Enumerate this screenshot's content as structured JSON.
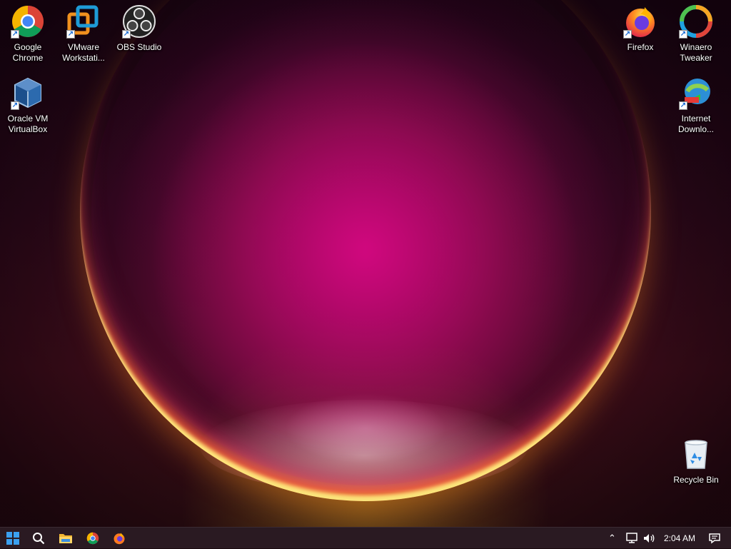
{
  "desktop": {
    "icons_left": [
      {
        "name": "google-chrome",
        "label": "Google\nChrome"
      },
      {
        "name": "vmware-workstation",
        "label": "VMware\nWorkstati..."
      },
      {
        "name": "obs-studio",
        "label": "OBS Studio"
      },
      {
        "name": "oracle-vm-virtualbox",
        "label": "Oracle VM\nVirtualBox"
      }
    ],
    "icons_right": [
      {
        "name": "firefox",
        "label": "Firefox"
      },
      {
        "name": "winaero-tweaker",
        "label": "Winaero\nTweaker"
      },
      {
        "name": "internet-download-manager",
        "label": "Internet\nDownlo..."
      },
      {
        "name": "recycle-bin",
        "label": "Recycle Bin"
      }
    ]
  },
  "taskbar": {
    "clock": "2:04 AM",
    "pinned": [
      "start",
      "search",
      "file-explorer",
      "chrome",
      "firefox"
    ],
    "accent": "#1e90ff"
  }
}
